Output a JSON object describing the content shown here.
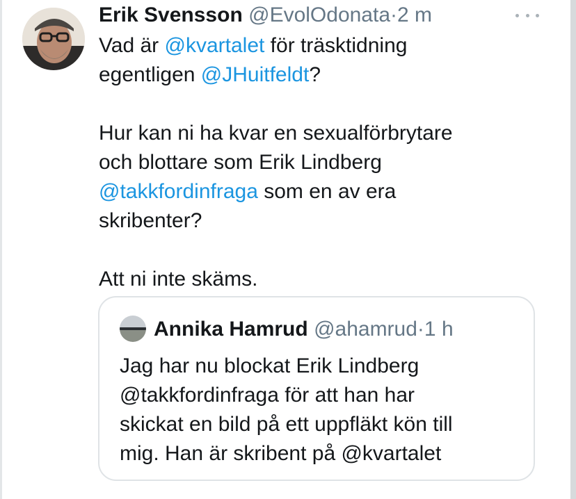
{
  "tweet": {
    "author_name": "Erik Svensson",
    "author_handle": "@EvolOdonata",
    "separator": "·",
    "time": "2 m",
    "more_icon": "more-horizontal-icon",
    "text": {
      "line1_pre": "Vad är ",
      "mention1": "@kvartalet",
      "line1_post": " för träsktidning",
      "line2_pre": "egentligen ",
      "mention2": "@JHuitfeldt",
      "line2_post": "?",
      "para2_a": "Hur kan ni ha kvar en sexualförbrytare",
      "para2_b": "och blottare som Erik Lindberg",
      "mention3": "@takkfordinfraga",
      "para2_c": " som en av era",
      "para2_d": "skribenter?",
      "para3": "Att ni inte skäms."
    }
  },
  "quoted_tweet": {
    "author_name": "Annika Hamrud",
    "author_handle": "@ahamrud",
    "separator": "·",
    "time": "1 h",
    "text": {
      "line1": "Jag har nu blockat Erik Lindberg",
      "line2": "@takkfordinfraga för att han har",
      "line3": "skickat en bild på ett uppfläkt kön till",
      "line4": "mig. Han är skribent på @kvartalet"
    }
  },
  "colors": {
    "text": "#14171a",
    "secondary": "#657786",
    "link": "#1b95e0",
    "border": "#dfe3e6"
  }
}
